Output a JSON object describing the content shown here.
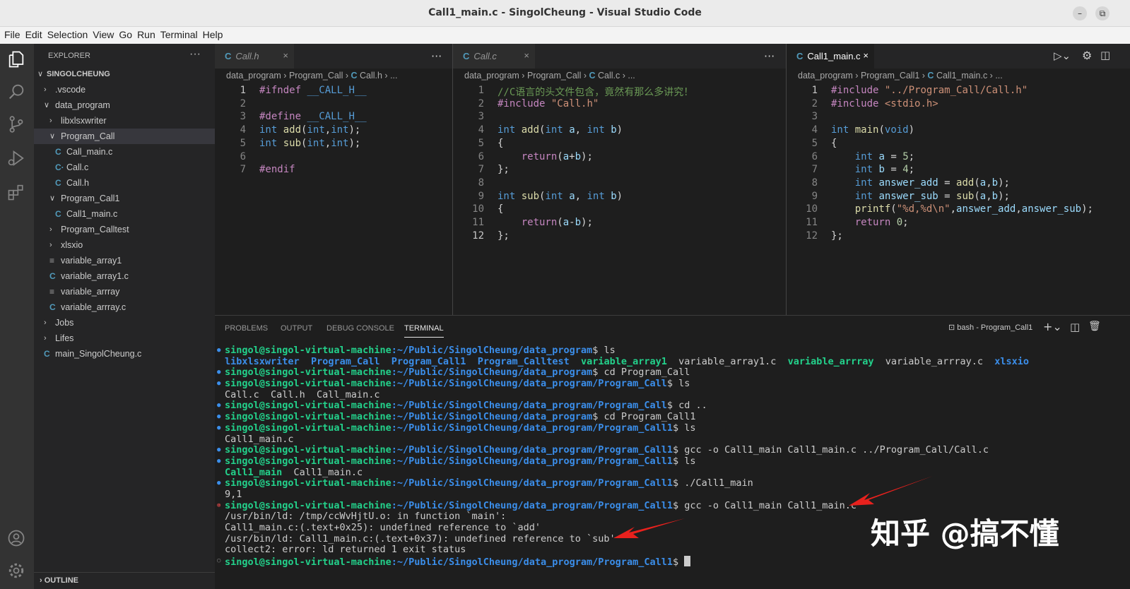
{
  "window": {
    "title": "Call1_main.c - SingolCheung - Visual Studio Code",
    "minimize": "–",
    "maximize": "⧉"
  },
  "menu": [
    "File",
    "Edit",
    "Selection",
    "View",
    "Go",
    "Run",
    "Terminal",
    "Help"
  ],
  "activity_bar": [
    "explorer-icon",
    "search-icon",
    "source-control-icon",
    "run-debug-icon",
    "extensions-icon",
    "account-icon",
    "settings-gear-icon"
  ],
  "explorer": {
    "header": "EXPLORER",
    "more": "···",
    "root": "SINGOLCHEUNG",
    "items": [
      {
        "label": ".vscode",
        "kind": "folder-closed"
      },
      {
        "label": "data_program",
        "kind": "folder-open"
      },
      {
        "label": "libxlsxwriter",
        "kind": "folder-closed"
      },
      {
        "label": "Program_Call",
        "kind": "folder-open",
        "selected": true
      },
      {
        "label": "Call_main.c",
        "kind": "c-file"
      },
      {
        "label": "Call.c",
        "kind": "c-modified-file"
      },
      {
        "label": "Call.h",
        "kind": "h-file"
      },
      {
        "label": "Program_Call1",
        "kind": "folder-open"
      },
      {
        "label": "Call1_main.c",
        "kind": "c-file"
      },
      {
        "label": "Program_Calltest",
        "kind": "folder-closed"
      },
      {
        "label": "xlsxio",
        "kind": "folder-closed"
      },
      {
        "label": "variable_array1",
        "kind": "binary-file"
      },
      {
        "label": "variable_array1.c",
        "kind": "c-file"
      },
      {
        "label": "variable_arrray",
        "kind": "binary-file"
      },
      {
        "label": "variable_arrray.c",
        "kind": "c-file"
      },
      {
        "label": "Jobs",
        "kind": "folder-closed"
      },
      {
        "label": "Lifes",
        "kind": "folder-closed"
      },
      {
        "label": "main_SingolCheung.c",
        "kind": "c-file"
      }
    ],
    "outline": "OUTLINE"
  },
  "editors": [
    {
      "tab": "Call.h",
      "tab_icon": "C",
      "close": "×",
      "more": "···",
      "breadcrumb": [
        "data_program",
        "Program_Call",
        "Call.h",
        "..."
      ],
      "lines": [
        "#ifndef __CALL_H__",
        "",
        "#define __CALL_H__",
        "int add(int,int);",
        "int sub(int,int);",
        "",
        "#endif"
      ]
    },
    {
      "tab": "Call.c",
      "tab_icon": "C",
      "close": "×",
      "more": "···",
      "breadcrumb": [
        "data_program",
        "Program_Call",
        "Call.c",
        "..."
      ],
      "lines": [
        "//C语言的头文件包含，竟然有那么多讲究！",
        "#include \"Call.h\"",
        "",
        "int add(int a, int b)",
        "{",
        "    return(a+b);",
        "};",
        "",
        "int sub(int a, int b)",
        "{",
        "    return(a-b);",
        "};"
      ]
    },
    {
      "tab": "Call1_main.c",
      "tab_icon": "C",
      "close": "×",
      "breadcrumb": [
        "data_program",
        "Program_Call1",
        "Call1_main.c",
        "..."
      ],
      "lines": [
        "#include \"../Program_Call/Call.h\"",
        "#include <stdio.h>",
        "",
        "int main(void)",
        "{",
        "    int a = 5;",
        "    int b = 4;",
        "    int answer_add = add(a,b);",
        "    int answer_sub = sub(a,b);",
        "    printf(\"%d,%d\\n\",answer_add,answer_sub);",
        "    return 0;",
        "};"
      ]
    }
  ],
  "panel": {
    "tabs": [
      "PROBLEMS",
      "OUTPUT",
      "DEBUG CONSOLE",
      "TERMINAL"
    ],
    "active_tab": "TERMINAL",
    "terminal_name": "bash - Program_Call1",
    "prompt_user": "singol@singol-virtual-machine",
    "lines": [
      {
        "type": "prompt",
        "status": "ok",
        "path": ":~/Public/SingolCheung/data_program",
        "cmd": "$ ls"
      },
      {
        "type": "ls1",
        "items": [
          "libxlsxwriter",
          "Program_Call",
          "Program_Call1",
          "Program_Calltest",
          "variable_array1",
          "variable_array1.c",
          "variable_arrray",
          "variable_arrray.c",
          "xlsxio"
        ]
      },
      {
        "type": "prompt",
        "status": "ok",
        "path": ":~/Public/SingolCheung/data_program",
        "cmd": "$ cd Program_Call"
      },
      {
        "type": "prompt",
        "status": "ok",
        "path": ":~/Public/SingolCheung/data_program/Program_Call",
        "cmd": "$ ls"
      },
      {
        "type": "out",
        "text": "Call.c  Call.h  Call_main.c"
      },
      {
        "type": "prompt",
        "status": "ok",
        "path": ":~/Public/SingolCheung/data_program/Program_Call",
        "cmd": "$ cd .."
      },
      {
        "type": "prompt",
        "status": "ok",
        "path": ":~/Public/SingolCheung/data_program",
        "cmd": "$ cd Program_Call1"
      },
      {
        "type": "prompt",
        "status": "ok",
        "path": ":~/Public/SingolCheung/data_program/Program_Call1",
        "cmd": "$ ls"
      },
      {
        "type": "out",
        "text": "Call1_main.c"
      },
      {
        "type": "prompt",
        "status": "ok",
        "path": ":~/Public/SingolCheung/data_program/Program_Call1",
        "cmd": "$ gcc -o Call1_main Call1_main.c ../Program_Call/Call.c"
      },
      {
        "type": "prompt",
        "status": "ok",
        "path": ":~/Public/SingolCheung/data_program/Program_Call1",
        "cmd": "$ ls"
      },
      {
        "type": "ls2",
        "exe": "Call1_main",
        "rest": "  Call1_main.c"
      },
      {
        "type": "prompt",
        "status": "ok",
        "path": ":~/Public/SingolCheung/data_program/Program_Call1",
        "cmd": "$ ./Call1_main"
      },
      {
        "type": "out",
        "text": "9,1"
      },
      {
        "type": "prompt",
        "status": "error",
        "path": ":~/Public/SingolCheung/data_program/Program_Call1",
        "cmd": "$ gcc -o Call1_main Call1_main.c"
      },
      {
        "type": "out",
        "text": "/usr/bin/ld: /tmp/ccWvHjtU.o: in function `main':"
      },
      {
        "type": "out",
        "text": "Call1_main.c:(.text+0x25): undefined reference to `add'"
      },
      {
        "type": "out",
        "text": "/usr/bin/ld: Call1_main.c:(.text+0x37): undefined reference to `sub'"
      },
      {
        "type": "out",
        "text": "collect2: error: ld returned 1 exit status"
      },
      {
        "type": "prompt",
        "status": "idle",
        "path": ":~/Public/SingolCheung/data_program/Program_Call1",
        "cmd": "$ "
      }
    ]
  },
  "watermark": "知乎 @搞不懂",
  "colors": {
    "prompt_user": "#23d18b",
    "prompt_path": "#3b8eea",
    "error_dot": "#f14c4c",
    "ok_dot": "#3b8eea",
    "arrow": "#e8211d"
  }
}
